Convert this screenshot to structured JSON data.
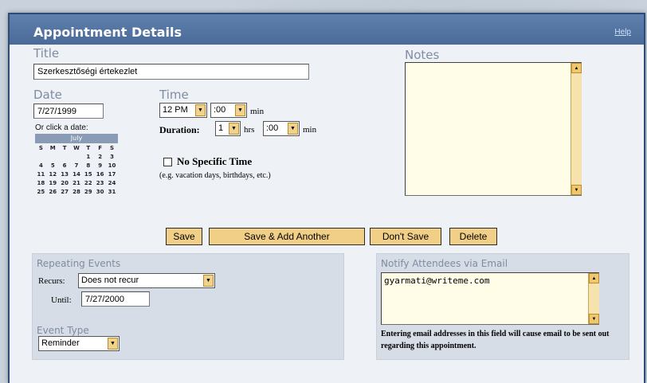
{
  "window": {
    "title": "Appointment Details",
    "help_label": "Help"
  },
  "title_field": {
    "label": "Title",
    "value": "Szerkesztőségi értekezlet"
  },
  "notes_field": {
    "label": "Notes",
    "value": ""
  },
  "date_field": {
    "label": "Date",
    "value": "7/27/1999",
    "calendar_hint": "Or click a date:"
  },
  "calendar": {
    "month": "July",
    "weekdays": [
      "S",
      "M",
      "T",
      "W",
      "T",
      "F",
      "S"
    ],
    "weeks": [
      [
        "",
        "",
        "",
        "",
        "1",
        "2",
        "3"
      ],
      [
        "4",
        "5",
        "6",
        "7",
        "8",
        "9",
        "10"
      ],
      [
        "11",
        "12",
        "13",
        "14",
        "15",
        "16",
        "17"
      ],
      [
        "18",
        "19",
        "20",
        "21",
        "22",
        "23",
        "24"
      ],
      [
        "25",
        "26",
        "27",
        "28",
        "29",
        "30",
        "31"
      ]
    ]
  },
  "time_field": {
    "label": "Time",
    "hour": "12 PM",
    "minute": ":00",
    "min_label": "min",
    "duration_label": "Duration:",
    "duration_hours": "1",
    "hrs_label": "hrs",
    "duration_minutes": ":00",
    "duration_min_label": "min"
  },
  "no_specific_time": {
    "label": "No Specific Time",
    "hint": "(e.g. vacation days, birthdays, etc.)",
    "checked": false
  },
  "buttons": {
    "save": "Save",
    "save_add": "Save & Add Another",
    "dont_save": "Don't Save",
    "delete": "Delete"
  },
  "repeating": {
    "label": "Repeating Events",
    "recurs_label": "Recurs:",
    "recurs_value": "Does not recur",
    "until_label": "Until:",
    "until_value": "7/27/2000"
  },
  "event_type": {
    "label": "Event Type",
    "value": "Reminder"
  },
  "notify": {
    "label": "Notify Attendees via Email",
    "value": "gyarmati@writeme.com",
    "hint": "Entering email addresses in this field will cause email to be sent out regarding this appointment."
  },
  "colors": {
    "titlebar": "#4f6f9d",
    "button": "#f2cf86",
    "panel": "#eef1f6"
  }
}
